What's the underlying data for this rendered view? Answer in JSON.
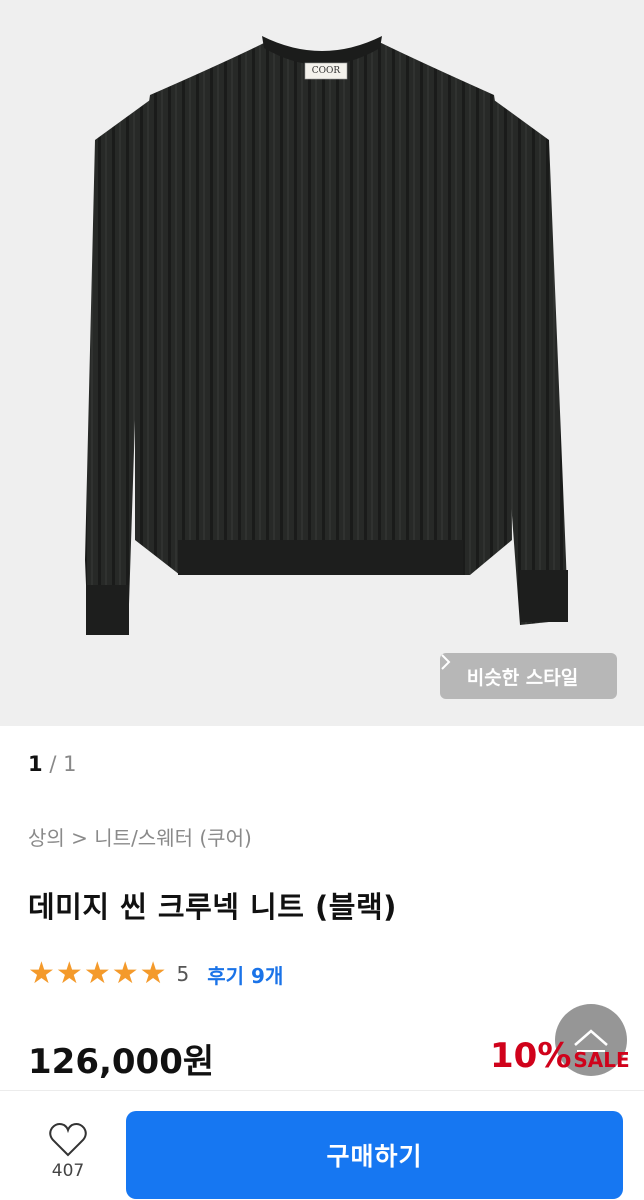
{
  "hero": {
    "brand_tag": "COOR",
    "similar_style_label": "비슷한 스타일"
  },
  "pager": {
    "current": "1",
    "separator": "/",
    "total": "1"
  },
  "product": {
    "breadcrumb": "상의 > 니트/스웨터 (쿠어)",
    "title": "데미지 씬 크루넥 니트 (블랙)",
    "rating": {
      "stars": 5,
      "value": "5",
      "review_label": "후기 9개"
    },
    "price": "126,000원",
    "discount": {
      "percent": "10%",
      "label": "SALE"
    }
  },
  "bottom_bar": {
    "wishlist_count": "407",
    "buy_label": "구매하기"
  },
  "colors": {
    "accent": "#1677f2",
    "sale": "#d0021b",
    "star": "#f49a2b",
    "review_link": "#1a73e8"
  }
}
